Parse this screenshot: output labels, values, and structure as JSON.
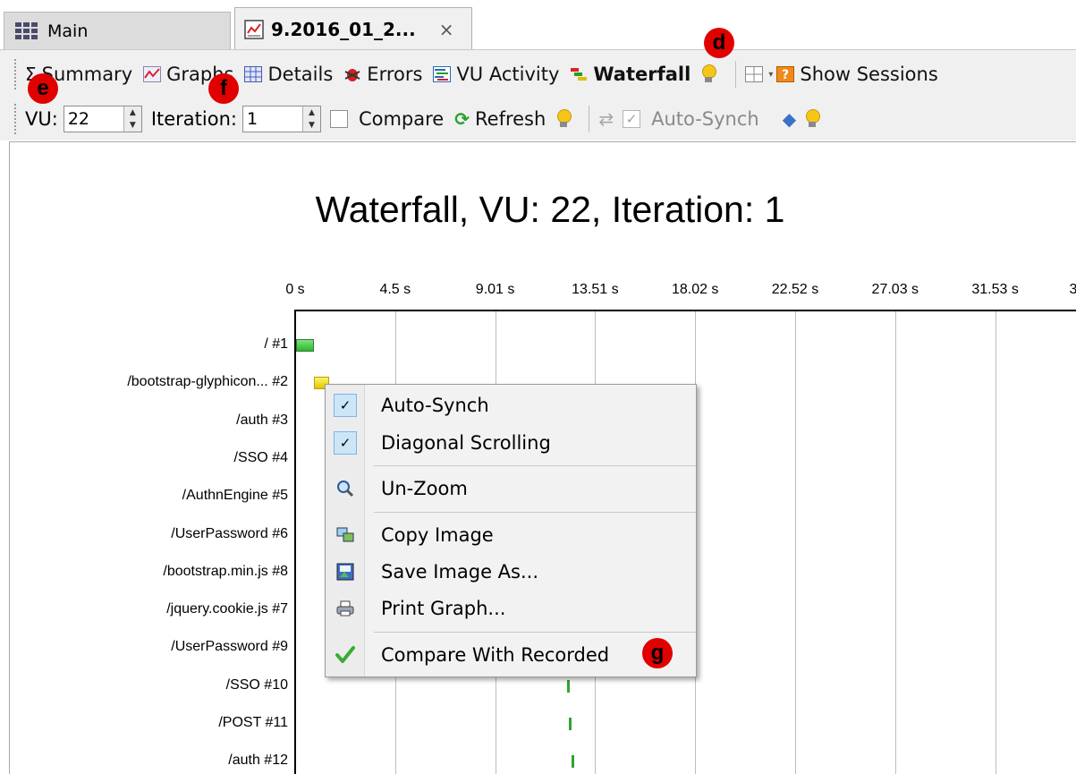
{
  "tabs": [
    {
      "label": "Main"
    },
    {
      "label": "9.2016_01_2...",
      "close": "×"
    }
  ],
  "toolbar1": {
    "summary": "Summary",
    "graphs": "Graphs",
    "details": "Details",
    "errors": "Errors",
    "vu_activity": "VU Activity",
    "waterfall": "Waterfall",
    "show_sessions": "Show Sessions"
  },
  "toolbar2": {
    "vu_label": "VU:",
    "vu_value": "22",
    "iteration_label": "Iteration:",
    "iteration_value": "1",
    "compare": "Compare",
    "refresh": "Refresh",
    "auto_synch": "Auto-Synch"
  },
  "markers": {
    "d": "d",
    "e": "e",
    "f": "f",
    "g": "g"
  },
  "context_menu": {
    "items": [
      {
        "label": "Auto-Synch",
        "checked": true
      },
      {
        "label": "Diagonal Scrolling",
        "checked": true
      },
      {
        "label": "Un-Zoom",
        "icon": "magnifier-icon"
      },
      {
        "label": "Copy Image",
        "icon": "copy-image-icon"
      },
      {
        "label": "Save Image As...",
        "icon": "save-image-icon"
      },
      {
        "label": "Print Graph...",
        "icon": "printer-icon"
      },
      {
        "label": "Compare With Recorded",
        "icon": "green-check-icon"
      }
    ]
  },
  "chart_data": {
    "type": "bar",
    "title": "Waterfall, VU: 22, Iteration: 1",
    "x_ticks": [
      "0 s",
      "4.5 s",
      "9.01 s",
      "13.51 s",
      "18.02 s",
      "22.52 s",
      "27.03 s",
      "31.53 s",
      "3"
    ],
    "categories": [
      "/ #1",
      "/bootstrap-glyphicon... #2",
      "/auth #3",
      "/SSO #4",
      "/AuthnEngine #5",
      "/UserPassword #6",
      "/bootstrap.min.js #8",
      "/jquery.cookie.js #7",
      "/UserPassword #9",
      "/SSO #10",
      "/POST #11",
      "/auth #12"
    ],
    "visible_bars": [
      {
        "row": 0,
        "start": 0.0,
        "end": 0.8,
        "color": "#3cc13c"
      },
      {
        "row": 1,
        "start": 0.8,
        "end": 1.5,
        "color": "#f0dc20"
      },
      {
        "row": 9,
        "start": 12.2,
        "end": 12.3,
        "color": "#2fa52f"
      },
      {
        "row": 10,
        "start": 12.3,
        "end": 12.4,
        "color": "#2fa52f"
      },
      {
        "row": 11,
        "start": 12.4,
        "end": 12.5,
        "color": "#2fa52f"
      }
    ],
    "xlim": [
      0,
      35
    ]
  }
}
